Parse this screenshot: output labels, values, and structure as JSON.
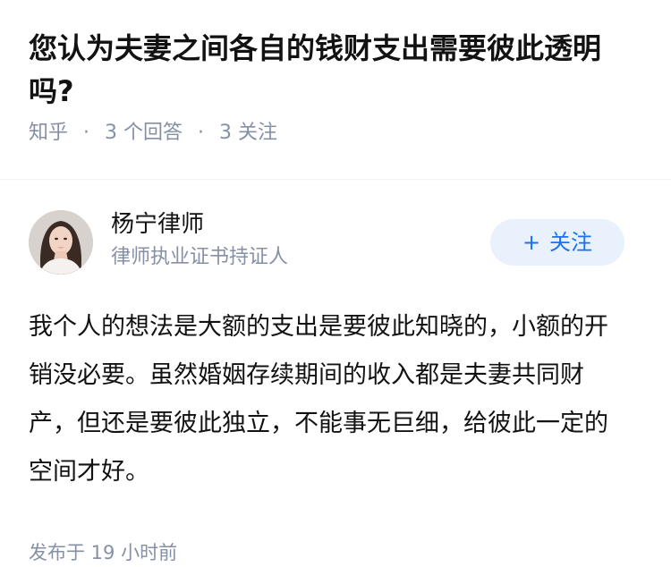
{
  "question": {
    "title": "您认为夫妻之间各自的钱财支出需要彼此透明吗?",
    "source": "知乎",
    "answers": "3 个回答",
    "follows": "3 关注"
  },
  "answer": {
    "author": {
      "name": "杨宁律师",
      "headline": "律师执业证书持证人",
      "avatar_icon": "avatar-photo-icon"
    },
    "follow_button": {
      "plus": "+",
      "label": "关注"
    },
    "content": "我个人的想法是大额的支出是要彼此知晓的，小额的开销没必要。虽然婚姻存续期间的收入都是夫妻共同财产，但还是要彼此独立，不能事无巨细，给彼此一定的空间才好。",
    "published": "发布于 19 小时前"
  },
  "colors": {
    "accent": "#1772f6",
    "accent_bg": "#e8f1fc",
    "muted": "#8590a6",
    "text": "#121212",
    "divider": "#f0f2f7"
  }
}
